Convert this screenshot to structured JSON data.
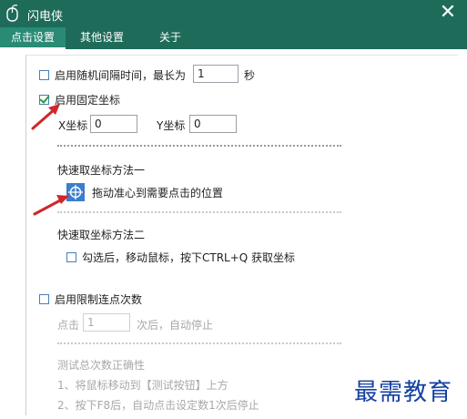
{
  "window": {
    "title": "闪电侠",
    "close_label": "✕"
  },
  "tabs": [
    {
      "label": "点击设置",
      "active": true
    },
    {
      "label": "其他设置",
      "active": false
    },
    {
      "label": "关于",
      "active": false
    }
  ],
  "random_interval": {
    "label": "启用随机间隔时间，最长为",
    "value": "1",
    "unit": "秒",
    "checked": false
  },
  "fixed_coord": {
    "label": "启用固定坐标",
    "checked": true,
    "x_label": "X坐标",
    "x_value": "0",
    "y_label": "Y坐标",
    "y_value": "0"
  },
  "method_one": {
    "heading": "快速取坐标方法一",
    "instruction": "拖动准心到需要点击的位置"
  },
  "method_two": {
    "heading": "快速取坐标方法二",
    "checkbox_label": "勾选后，移动鼠标，按下CTRL+Q 获取坐标",
    "checked": false
  },
  "limit_clicks": {
    "label": "启用限制连点次数",
    "checked": false,
    "prefix": "点击",
    "value": "1",
    "suffix": "次后，自动停止"
  },
  "test": {
    "heading": "测试总次数正确性",
    "step1": "1、将鼠标移动到【测试按钮】上方",
    "step2": "2、按下F8后，自动点击设定数1次后停止"
  },
  "watermark": "最需教育",
  "colors": {
    "titlebar": "#1e6b5a",
    "active_tab": "#2a8b74",
    "arrow": "#d0262a",
    "watermark": "#1440a0"
  }
}
